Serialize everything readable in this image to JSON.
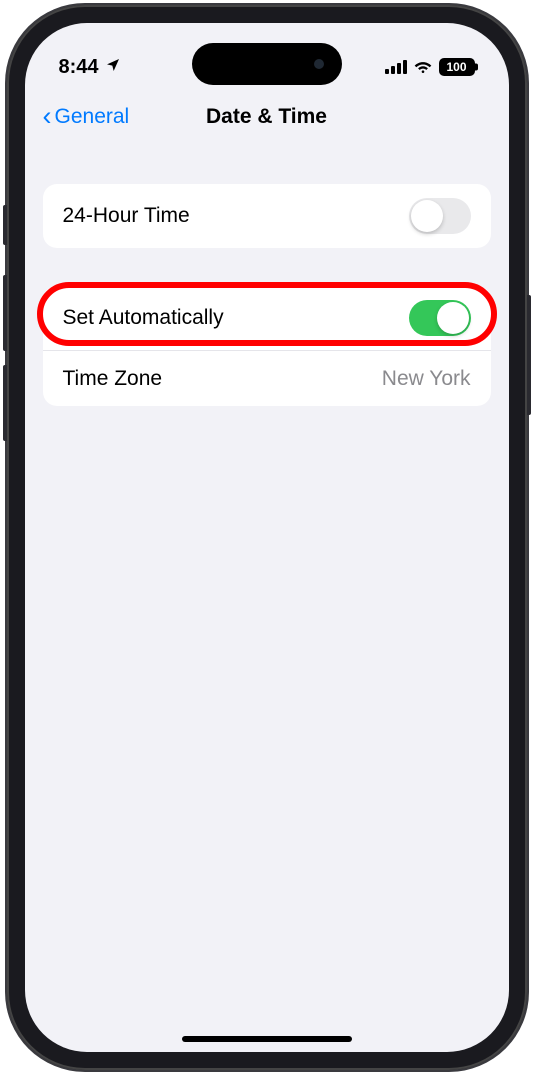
{
  "statusBar": {
    "time": "8:44",
    "batteryLevel": "100"
  },
  "nav": {
    "backLabel": "General",
    "title": "Date & Time"
  },
  "group1": {
    "row1": {
      "label": "24-Hour Time"
    }
  },
  "group2": {
    "row1": {
      "label": "Set Automatically"
    },
    "row2": {
      "label": "Time Zone",
      "value": "New York"
    }
  }
}
